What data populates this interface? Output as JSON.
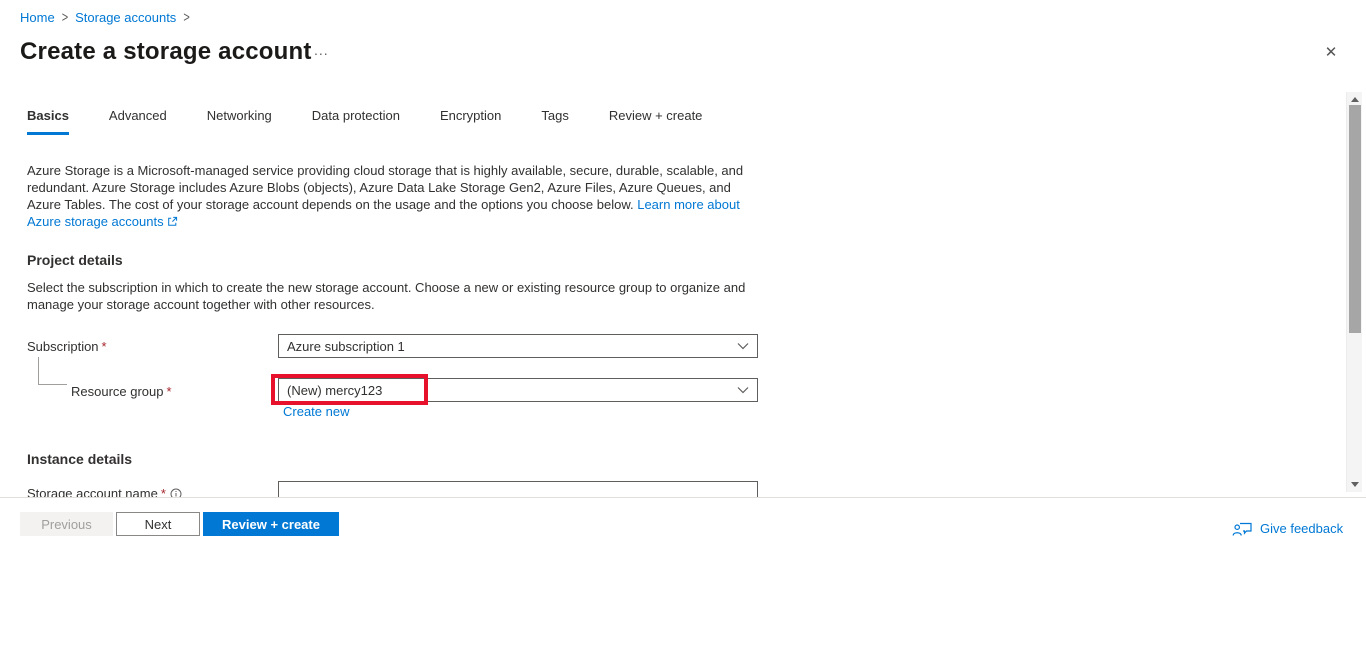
{
  "breadcrumb": {
    "items": [
      {
        "label": "Home"
      },
      {
        "label": "Storage accounts"
      }
    ],
    "separator": ">"
  },
  "header": {
    "title": "Create a storage account",
    "more_label": "...",
    "close_glyph": "✕"
  },
  "tabs": [
    {
      "label": "Basics",
      "active": true
    },
    {
      "label": "Advanced",
      "active": false
    },
    {
      "label": "Networking",
      "active": false
    },
    {
      "label": "Data protection",
      "active": false
    },
    {
      "label": "Encryption",
      "active": false
    },
    {
      "label": "Tags",
      "active": false
    },
    {
      "label": "Review + create",
      "active": false
    }
  ],
  "intro": {
    "text": "Azure Storage is a Microsoft-managed service providing cloud storage that is highly available, secure, durable, scalable, and redundant. Azure Storage includes Azure Blobs (objects), Azure Data Lake Storage Gen2, Azure Files, Azure Queues, and Azure Tables. The cost of your storage account depends on the usage and the options you choose below. ",
    "link_label": "Learn more about Azure storage accounts",
    "external_link_icon": "open-in-new-window"
  },
  "project_details": {
    "heading": "Project details",
    "description": "Select the subscription in which to create the new storage account. Choose a new or existing resource group to organize and manage your storage account together with other resources.",
    "subscription": {
      "label": "Subscription",
      "required_marker": "*",
      "value": "Azure subscription 1"
    },
    "resource_group": {
      "label": "Resource group",
      "required_marker": "*",
      "value": "(New) mercy123",
      "create_new_label": "Create new"
    }
  },
  "instance_details": {
    "heading": "Instance details",
    "storage_account_name": {
      "label": "Storage account name",
      "required_marker": "*",
      "value": ""
    }
  },
  "footer": {
    "previous_label": "Previous",
    "next_label": "Next",
    "review_create_label": "Review + create",
    "feedback_label": "Give feedback"
  },
  "colors": {
    "accent_blue": "#0078d4",
    "annotation_red": "#e8112b",
    "required_marker_red": "#a4262c",
    "text_primary": "#323130",
    "text_secondary": "#605e5c",
    "scrollbar_thumb": "#a6a6a6"
  }
}
